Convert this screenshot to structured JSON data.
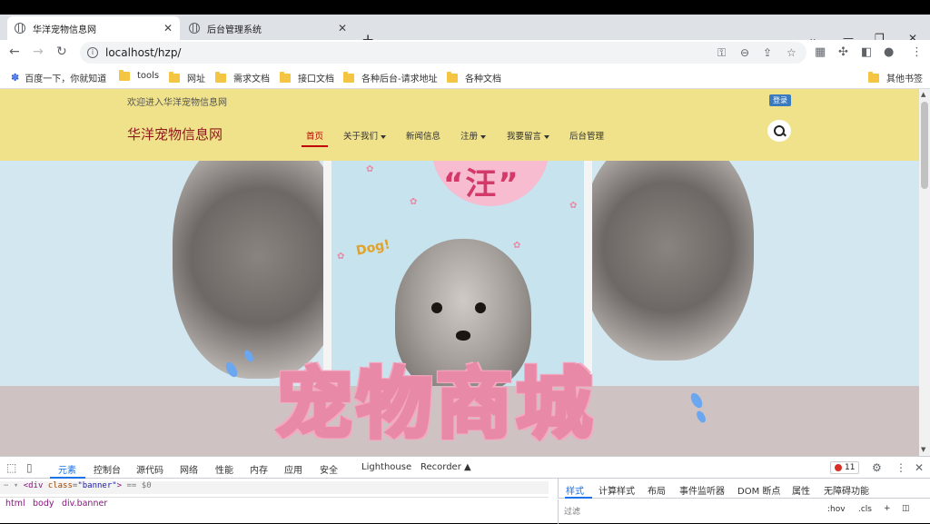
{
  "browser": {
    "tabs": [
      {
        "title": "华洋宠物信息网",
        "active": true
      },
      {
        "title": "后台管理系统",
        "active": false
      }
    ],
    "url": "localhost/hzp/",
    "bookmarks": [
      {
        "label": "百度一下，你就知道",
        "icon": "paw-icon"
      },
      {
        "label": "tools",
        "icon": "folder-icon"
      },
      {
        "label": "网址",
        "icon": "folder-icon"
      },
      {
        "label": "需求文档",
        "icon": "folder-icon"
      },
      {
        "label": "接口文档",
        "icon": "folder-icon"
      },
      {
        "label": "各种后台-请求地址",
        "icon": "folder-icon"
      },
      {
        "label": "各种文档",
        "icon": "folder-icon"
      }
    ],
    "other_bookmarks": "其他书签"
  },
  "site": {
    "welcome": "欢迎进入华洋宠物信息网",
    "login": "登录",
    "title": "华洋宠物信息网",
    "menu": [
      {
        "label": "首页",
        "active": true,
        "dropdown": false
      },
      {
        "label": "关于我们",
        "active": false,
        "dropdown": true
      },
      {
        "label": "新闻信息",
        "active": false,
        "dropdown": false
      },
      {
        "label": "注册",
        "active": false,
        "dropdown": true
      },
      {
        "label": "我要留言",
        "active": false,
        "dropdown": true
      },
      {
        "label": "后台管理",
        "active": false,
        "dropdown": false
      }
    ],
    "banner": {
      "wang": "“汪”",
      "dog_word": "Dog!"
    },
    "colors": {
      "header_bg": "#f0e28a",
      "title": "#8b1a1a",
      "active_menu": "#c00000",
      "login_bg": "#3a7bbf"
    }
  },
  "overlay_title": [
    "宠",
    "物",
    "商",
    "城"
  ],
  "devtools": {
    "tabs": [
      "元素",
      "控制台",
      "源代码",
      "网络",
      "性能",
      "内存",
      "应用",
      "安全",
      "Lighthouse",
      "Recorder"
    ],
    "error_count": "11",
    "code": {
      "tag_open": "<div",
      "attr": "class",
      "value": "\"banner\"",
      "tag_close": ">",
      "marker": "== $0"
    },
    "breadcrumbs": [
      "html",
      "body",
      "div.banner"
    ],
    "side_tabs": [
      "样式",
      "计算样式",
      "布局",
      "事件监听器",
      "DOM 断点",
      "属性",
      "无障碍功能"
    ],
    "filter_placeholder": "过滤",
    "filter_tools": [
      ":hov",
      ".cls",
      "+"
    ]
  }
}
